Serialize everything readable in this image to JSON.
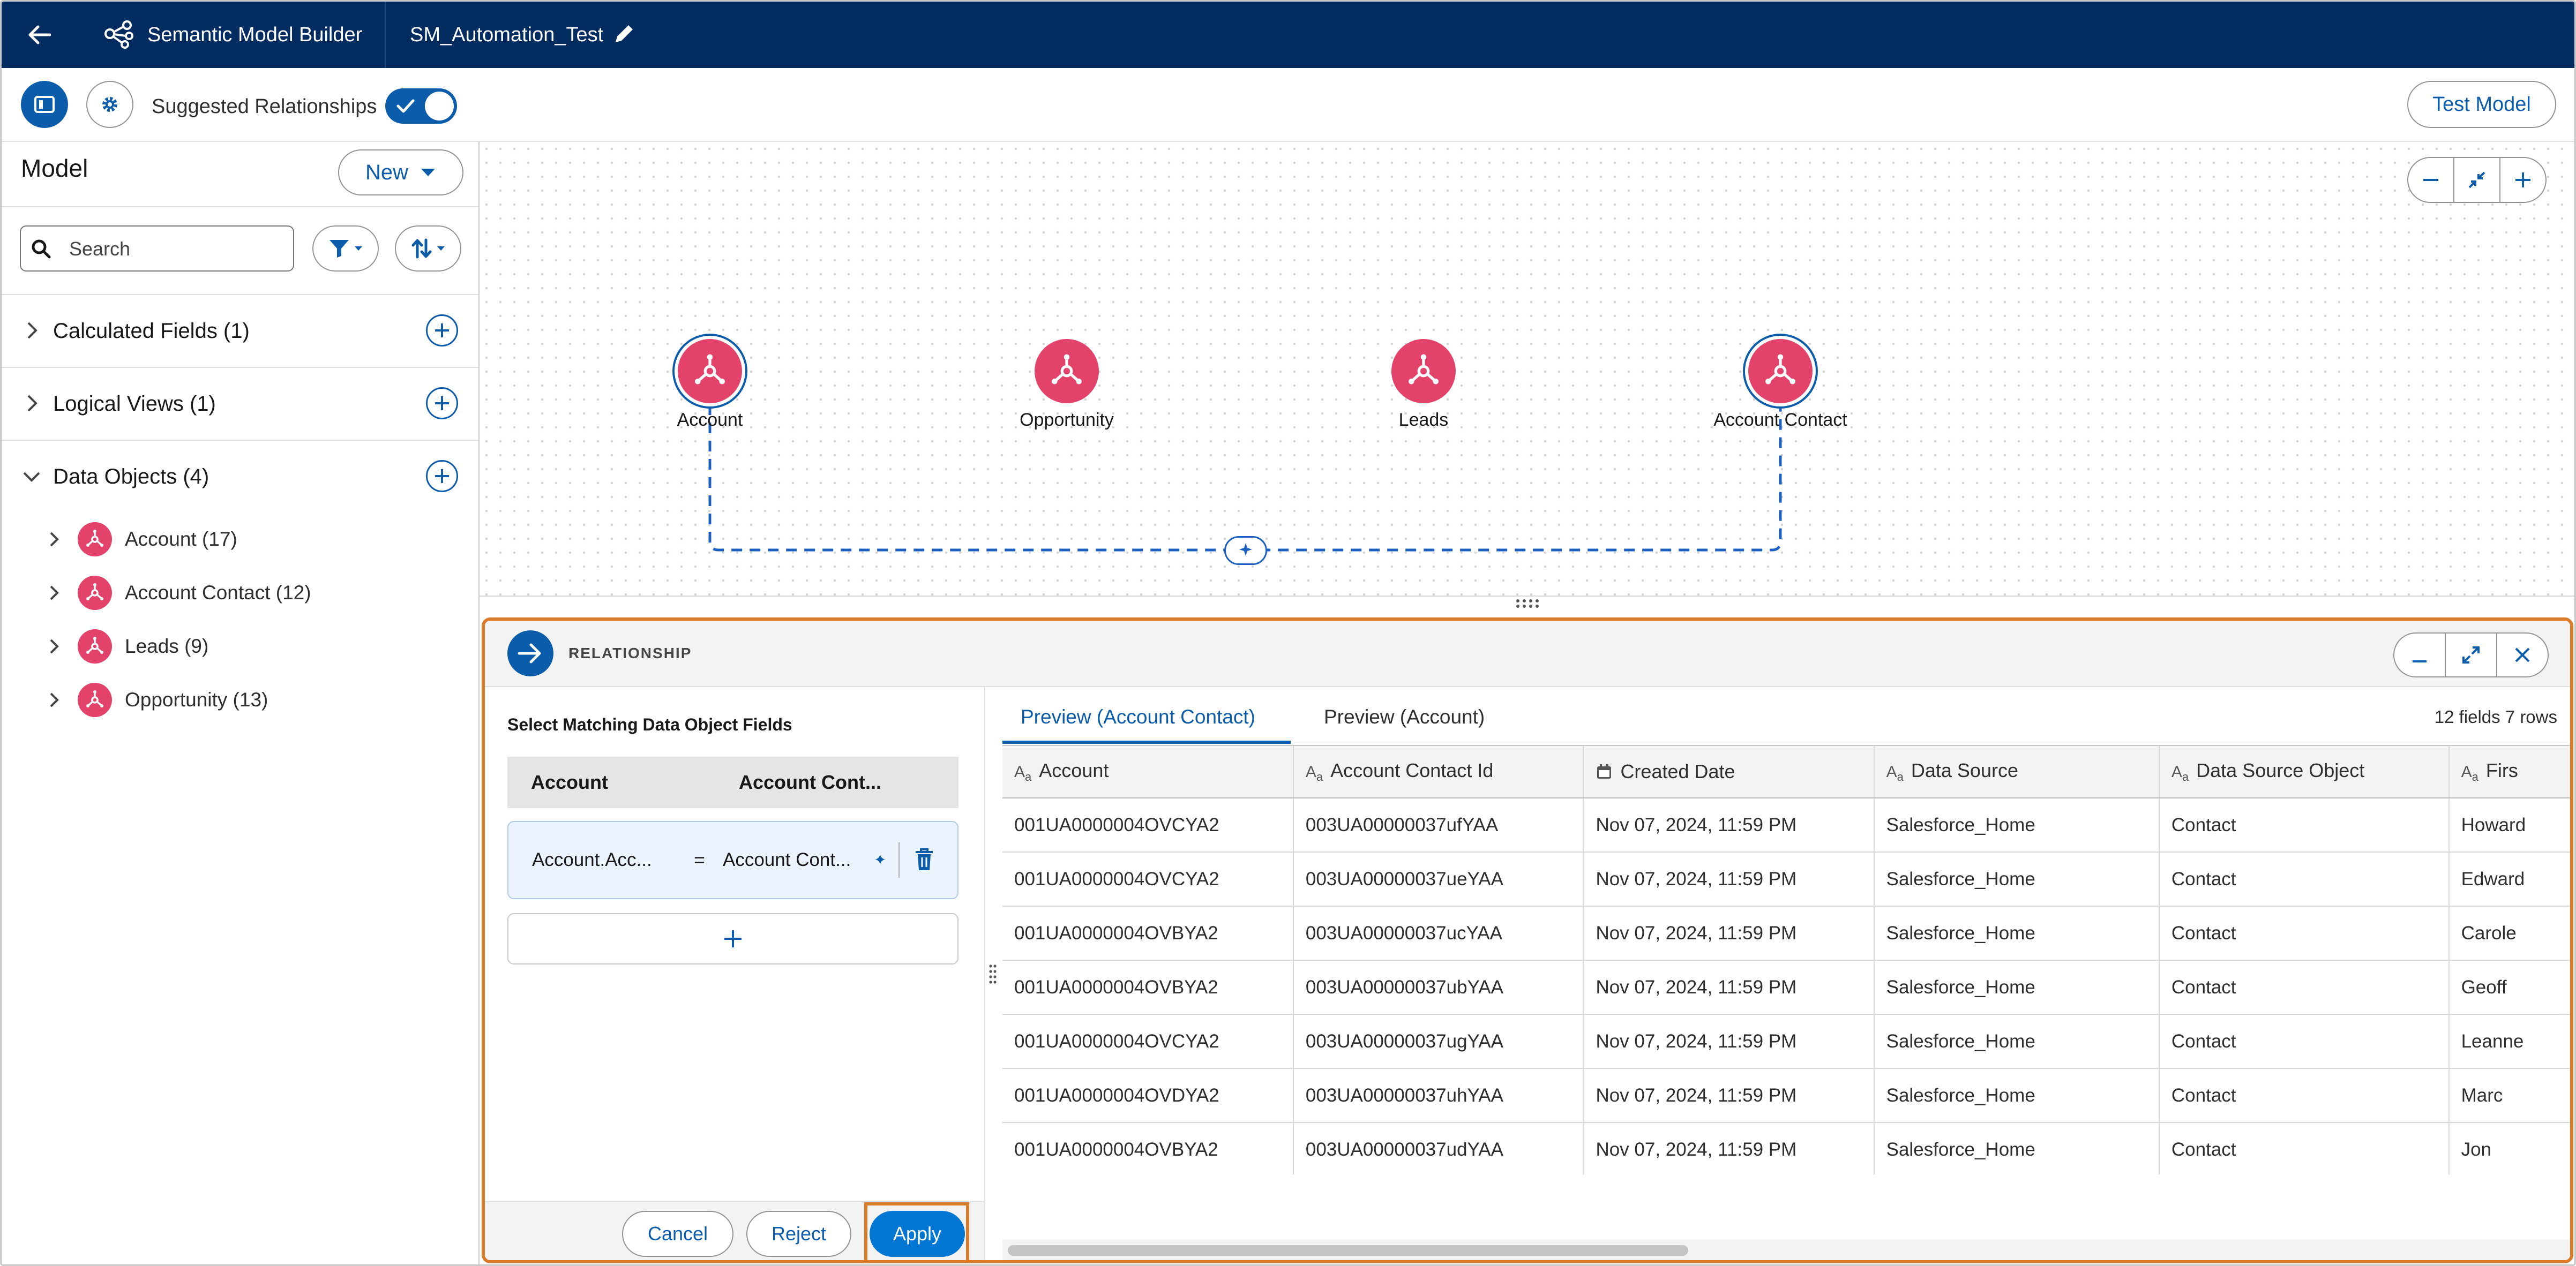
{
  "header": {
    "app_title": "Semantic Model Builder",
    "model_name": "SM_Automation_Test"
  },
  "toolbar": {
    "suggested_relationships_label": "Suggested Relationships",
    "suggested_relationships_on": true,
    "test_model_label": "Test Model"
  },
  "sidebar": {
    "title": "Model",
    "new_label": "New",
    "search_placeholder": "Search",
    "sections": [
      {
        "label": "Calculated Fields (1)"
      },
      {
        "label": "Logical Views (1)"
      },
      {
        "label": "Data Objects (4)"
      }
    ],
    "data_objects": [
      {
        "label": "Account (17)"
      },
      {
        "label": "Account Contact (12)"
      },
      {
        "label": "Leads (9)"
      },
      {
        "label": "Opportunity (13)"
      }
    ]
  },
  "canvas": {
    "nodes": [
      {
        "label": "Account"
      },
      {
        "label": "Opportunity"
      },
      {
        "label": "Leads"
      },
      {
        "label": "Account Contact"
      }
    ]
  },
  "relationship": {
    "title": "RELATIONSHIP",
    "match_title": "Select Matching Data Object Fields",
    "col_left": "Account",
    "col_right": "Account Cont...",
    "field_left": "Account.Acc...",
    "operator": "=",
    "field_right": "Account Cont...",
    "cancel_label": "Cancel",
    "reject_label": "Reject",
    "apply_label": "Apply",
    "tab_active": "Preview (Account Contact)",
    "tab_other": "Preview (Account)",
    "rows_info": "12 fields 7 rows",
    "columns": [
      "Account",
      "Account Contact Id",
      "Created Date",
      "Data Source",
      "Data Source Object",
      "Firs"
    ],
    "rows": [
      [
        "001UA0000004OVCYA2",
        "003UA00000037ufYAA",
        "Nov 07, 2024, 11:59 PM",
        "Salesforce_Home",
        "Contact",
        "Howard"
      ],
      [
        "001UA0000004OVCYA2",
        "003UA00000037ueYAA",
        "Nov 07, 2024, 11:59 PM",
        "Salesforce_Home",
        "Contact",
        "Edward"
      ],
      [
        "001UA0000004OVBYA2",
        "003UA00000037ucYAA",
        "Nov 07, 2024, 11:59 PM",
        "Salesforce_Home",
        "Contact",
        "Carole"
      ],
      [
        "001UA0000004OVBYA2",
        "003UA00000037ubYAA",
        "Nov 07, 2024, 11:59 PM",
        "Salesforce_Home",
        "Contact",
        "Geoff"
      ],
      [
        "001UA0000004OVCYA2",
        "003UA00000037ugYAA",
        "Nov 07, 2024, 11:59 PM",
        "Salesforce_Home",
        "Contact",
        "Leanne"
      ],
      [
        "001UA0000004OVDYA2",
        "003UA00000037uhYAA",
        "Nov 07, 2024, 11:59 PM",
        "Salesforce_Home",
        "Contact",
        "Marc"
      ],
      [
        "001UA0000004OVBYA2",
        "003UA00000037udYAA",
        "Nov 07, 2024, 11:59 PM",
        "Salesforce_Home",
        "Contact",
        "Jon"
      ]
    ]
  },
  "colors": {
    "header_bg": "#032d60",
    "brand_blue": "#0b5cab",
    "object_pink": "#e3436b",
    "highlight_orange": "#d97b29"
  },
  "icons": [
    "back-arrow-icon",
    "model-builder-icon",
    "pencil-icon",
    "panel-toggle-icon",
    "gear-icon",
    "check-icon",
    "search-icon",
    "filter-icon",
    "sort-icon",
    "chevron-right-icon",
    "chevron-down-icon",
    "add-icon",
    "data-object-icon",
    "zoom-out-icon",
    "fit-icon",
    "zoom-in-icon",
    "relationship-arrow-icon",
    "minimize-icon",
    "expand-icon",
    "close-icon",
    "sparkle-icon",
    "trash-icon",
    "text-type-icon",
    "calendar-icon"
  ]
}
